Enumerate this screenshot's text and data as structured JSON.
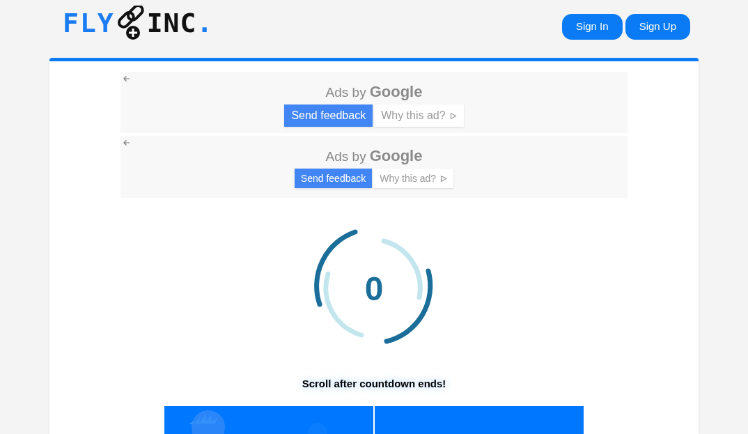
{
  "logo": {
    "left": "FLY",
    "right": "INC",
    "dot": "."
  },
  "nav": [
    {
      "label": "Sign In"
    },
    {
      "label": "Sign Up"
    }
  ],
  "ads": [
    {
      "prefix": "Ads by",
      "brand": "Google",
      "feedback": "Send feedback",
      "why": "Why this ad?",
      "kind": "large"
    },
    {
      "prefix": "Ads by",
      "brand": "Google",
      "feedback": "Send feedback",
      "why": "Why this ad?",
      "kind": "small"
    }
  ],
  "countdown": {
    "value": "0"
  },
  "message": "Scroll after countdown ends!",
  "panels": [
    {
      "kind": "picture"
    },
    {
      "kind": "plain"
    }
  ]
}
